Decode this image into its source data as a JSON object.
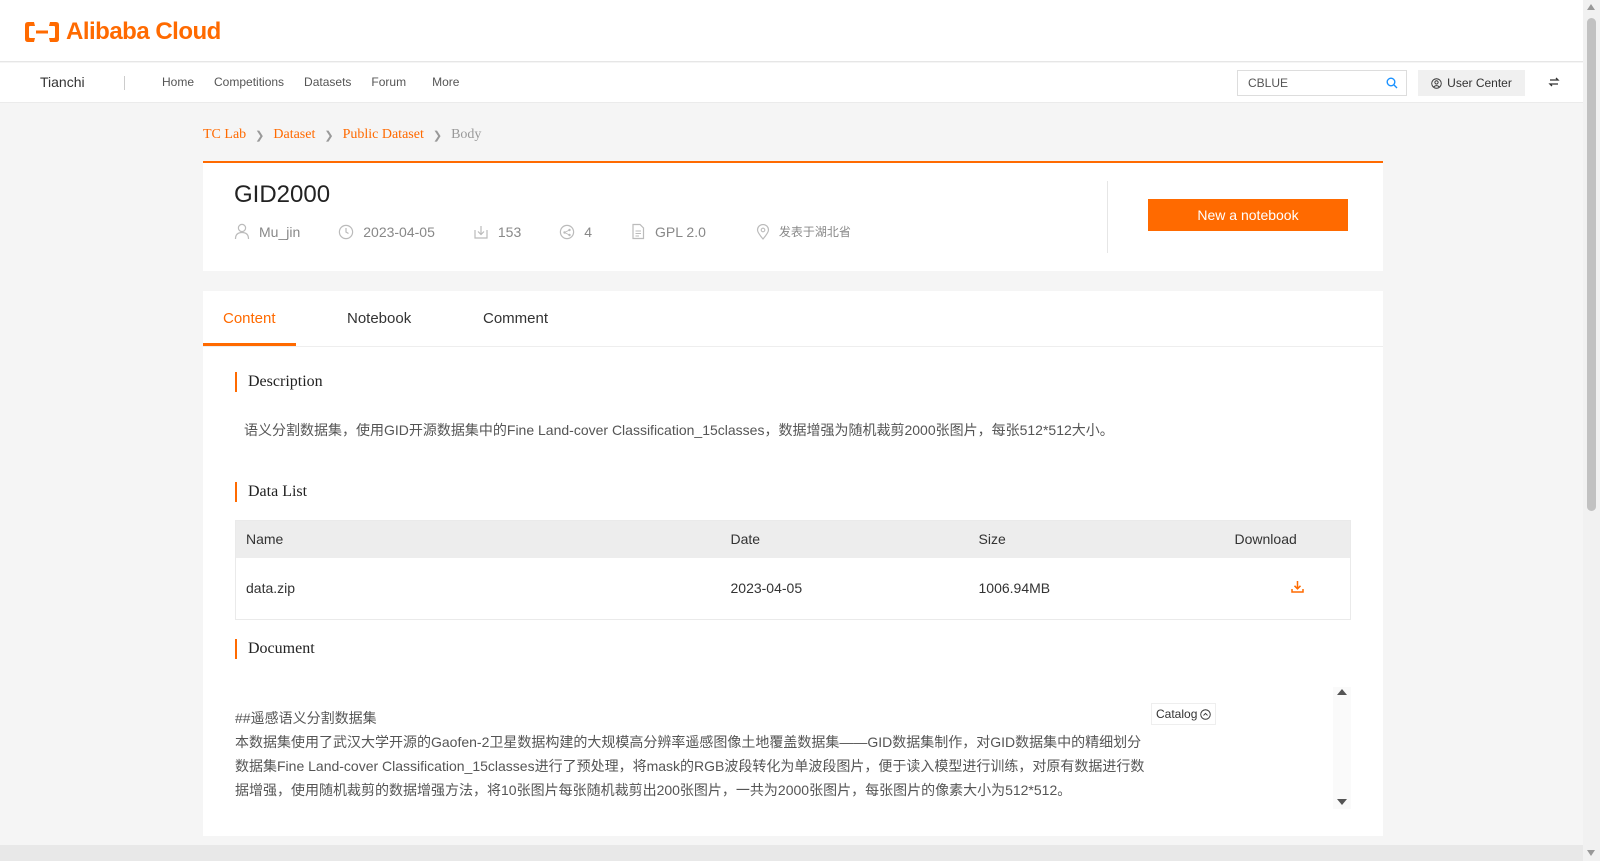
{
  "header": {
    "logo_text": "Alibaba Cloud",
    "brand_color": "#ff6a00"
  },
  "nav": {
    "brand": "Tianchi",
    "links": [
      "Home",
      "Competitions",
      "Datasets",
      "Forum",
      "More"
    ],
    "search_value": "CBLUE",
    "user_center": "User Center"
  },
  "breadcrumb": [
    "TC Lab",
    "Dataset",
    "Public Dataset",
    "Body"
  ],
  "dataset": {
    "title": "GID2000",
    "author": "Mu_jin",
    "date": "2023-04-05",
    "downloads": "153",
    "shares": "4",
    "license": "GPL 2.0",
    "location": "发表于湖北省",
    "new_notebook": "New a notebook"
  },
  "tabs": [
    "Content",
    "Notebook",
    "Comment"
  ],
  "sections": {
    "description_title": "Description",
    "description": "语义分割数据集，使用GID开源数据集中的Fine Land-cover Classification_15classes，数据增强为随机裁剪2000张图片，每张512*512大小。",
    "data_list_title": "Data List",
    "document_title": "Document"
  },
  "table": {
    "headers": [
      "Name",
      "Date",
      "Size",
      "Download"
    ],
    "rows": [
      {
        "name": "data.zip",
        "date": "2023-04-05",
        "size": "1006.94MB"
      }
    ]
  },
  "document": {
    "heading": "##遥感语义分割数据集",
    "lines": [
      "本数据集使用了武汉大学开源的Gaofen-2卫星数据构建的大规模高分辨率遥感图像土地覆盖数据集——GID数据集制作，对GID数据集中的精细划分",
      "数据集Fine Land-cover Classification_15classes进行了预处理，将mask的RGB波段转化为单波段图片，便于读入模型进行训练，对原有数据进行数",
      "据增强，使用随机裁剪的数据增强方法，将10张图片每张随机裁剪出200张图片，一共为2000张图片，每张图片的像素大小为512*512。"
    ],
    "catalog": "Catalog"
  }
}
